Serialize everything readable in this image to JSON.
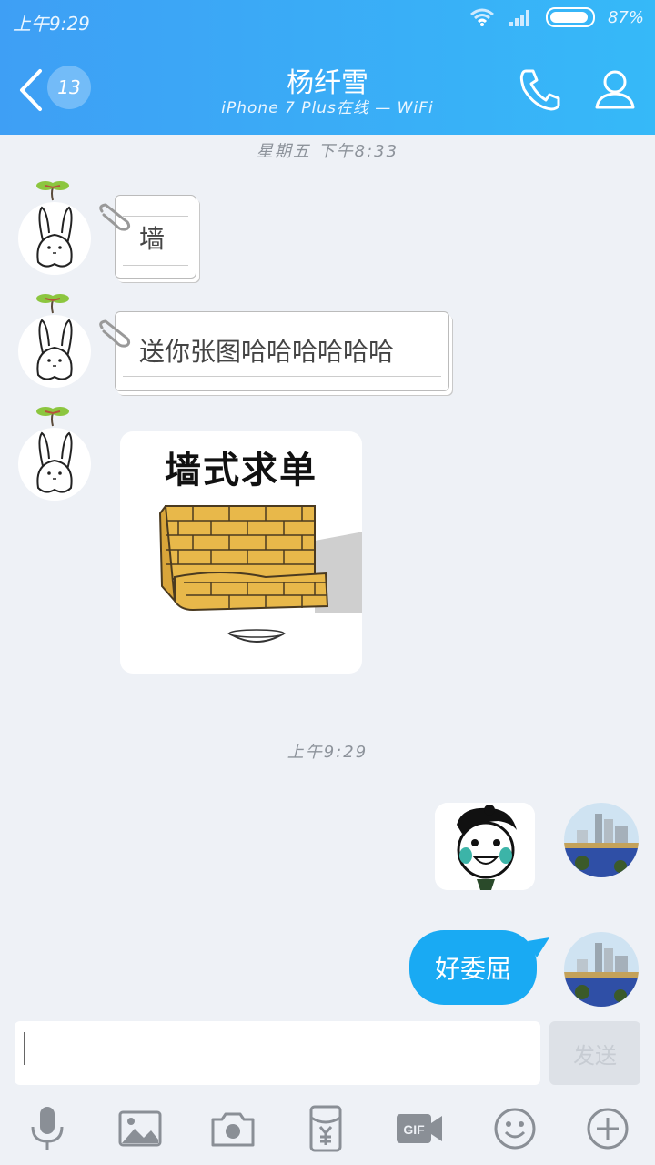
{
  "status_bar": {
    "time": "上午9:29",
    "battery": "87%"
  },
  "header": {
    "unread_count": "13",
    "contact_name": "杨纤雪",
    "presence": "iPhone 7 Plus在线 — WiFi"
  },
  "messages": {
    "timestamp_1": "星期五 下午8:33",
    "msg_1": "墙",
    "msg_2": "送你张图哈哈哈哈哈哈",
    "meme_caption": "墙式求单",
    "timestamp_2": "上午9:29",
    "msg_self": "好委屈"
  },
  "composer": {
    "send_label": "发送"
  },
  "toolbar": {
    "icons": [
      "microphone-icon",
      "image-icon",
      "camera-icon",
      "red-packet-icon",
      "gif-icon",
      "emoji-icon",
      "plus-icon"
    ]
  },
  "colors": {
    "header_start": "#3e9ff5",
    "header_end": "#36b9f8",
    "bubble": "#19aaf3",
    "background": "#eef1f6"
  }
}
